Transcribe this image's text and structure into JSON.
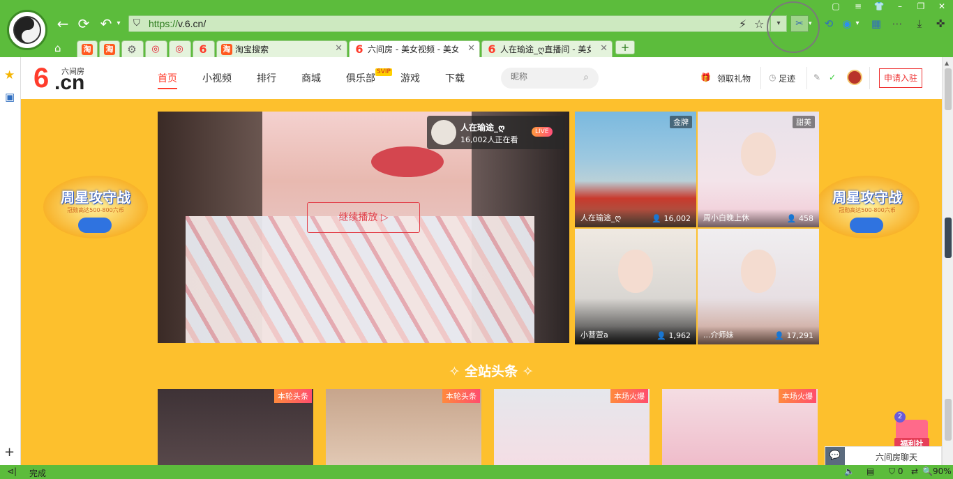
{
  "browser": {
    "url_protocol": "https://",
    "url_rest": "v.6.cn/",
    "tabs": [
      {
        "label": "淘宝搜索",
        "favicon": "淘",
        "active": false
      },
      {
        "label": "六间房 - 美女视频 - 美女",
        "favicon": "6",
        "active": true
      },
      {
        "label": "人在瑜途_ღ直播间 - 美女",
        "favicon": "6",
        "active": false
      }
    ],
    "status_text": "完成",
    "status_zoom": "90%",
    "status_count": "0"
  },
  "site": {
    "logo_text": "6.cn",
    "logo_sub": "六间房",
    "nav": [
      "首页",
      "小视频",
      "排行",
      "商城",
      "俱乐部",
      "游戏",
      "下载"
    ],
    "svip_badge": "SVIP",
    "search_placeholder": "昵称",
    "gift_link": "领取礼物",
    "history_link": "足迹",
    "apply_button": "申请入驻"
  },
  "banner": {
    "title": "周星攻守战",
    "subtitle": "冠勋高达500-800六币"
  },
  "player": {
    "resume_button": "继续播放",
    "anchor_name": "人在瑜途_ღ",
    "viewers": "16,002人正在看",
    "live_badge": "LIVE"
  },
  "thumbs": [
    {
      "tag": "金牌",
      "name": "人在瑜途_ღ",
      "count": "16,002"
    },
    {
      "tag": "甜美",
      "name": "周小白晚上休",
      "count": "458"
    },
    {
      "tag": "",
      "name": "小菩萱a",
      "count": "1,962"
    },
    {
      "tag": "",
      "name": "...介师妹",
      "count": "17,291"
    }
  ],
  "headline_title": "全站头条",
  "cards": [
    {
      "tag": "本轮头条"
    },
    {
      "tag": "本轮头条"
    },
    {
      "tag": "本场火爆"
    },
    {
      "tag": "本场火爆"
    }
  ],
  "floating": {
    "fuli_badge": "2",
    "fuli_label": "福利社",
    "chat_label": "六间房聊天"
  },
  "colors": {
    "browser_green": "#5cbc3c",
    "page_yellow": "#fdc02d",
    "brand_red": "#ff3c2c"
  }
}
